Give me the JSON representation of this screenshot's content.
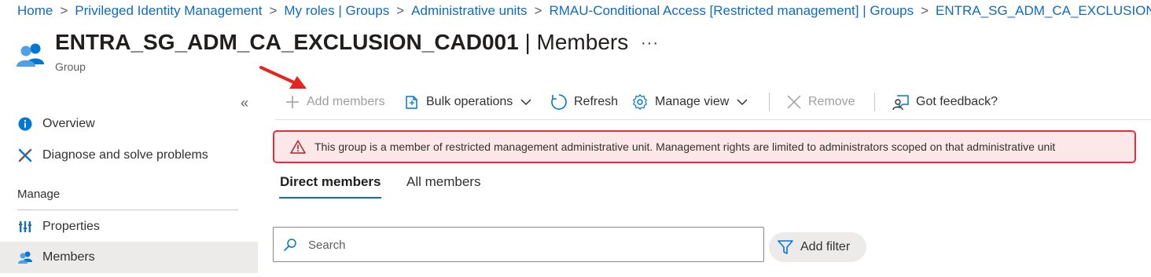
{
  "breadcrumb": [
    "Home",
    "Privileged Identity Management",
    "My roles | Groups",
    "Administrative units",
    "RMAU-Conditional Access [Restricted management] | Groups",
    "ENTRA_SG_ADM_CA_EXCLUSION"
  ],
  "breadcrumb_separator": ">",
  "header": {
    "title_strong": "ENTRA_SG_ADM_CA_EXCLUSION_CAD001",
    "title_weak": " | Members",
    "more": "···",
    "subtitle": "Group",
    "icon": "group-icon"
  },
  "sidebar": {
    "collapse": "«",
    "items": [
      {
        "label": "Overview",
        "icon": "info-icon"
      },
      {
        "label": "Diagnose and solve problems",
        "icon": "wrench-icon"
      }
    ],
    "section": "Manage",
    "manage_items": [
      {
        "label": "Properties",
        "icon": "properties-icon"
      },
      {
        "label": "Members",
        "icon": "members-icon",
        "selected": true
      }
    ]
  },
  "toolbar": {
    "add_members": "Add members",
    "bulk_operations": "Bulk operations",
    "refresh": "Refresh",
    "manage_view": "Manage view",
    "remove": "Remove",
    "feedback": "Got feedback?"
  },
  "banner": {
    "message": "This group is a member of restricted management administrative unit. Management rights are limited to administrators scoped on that administrative unit",
    "icon": "warning-icon"
  },
  "tabs": [
    "Direct members",
    "All members"
  ],
  "search": {
    "placeholder": "Search"
  },
  "filter": {
    "label": "Add filter"
  },
  "colors": {
    "link": "#0f6cbd",
    "banner_bg": "#fde7e9",
    "banner_border": "#e0303a",
    "annotation_arrow": "#e8231d"
  }
}
